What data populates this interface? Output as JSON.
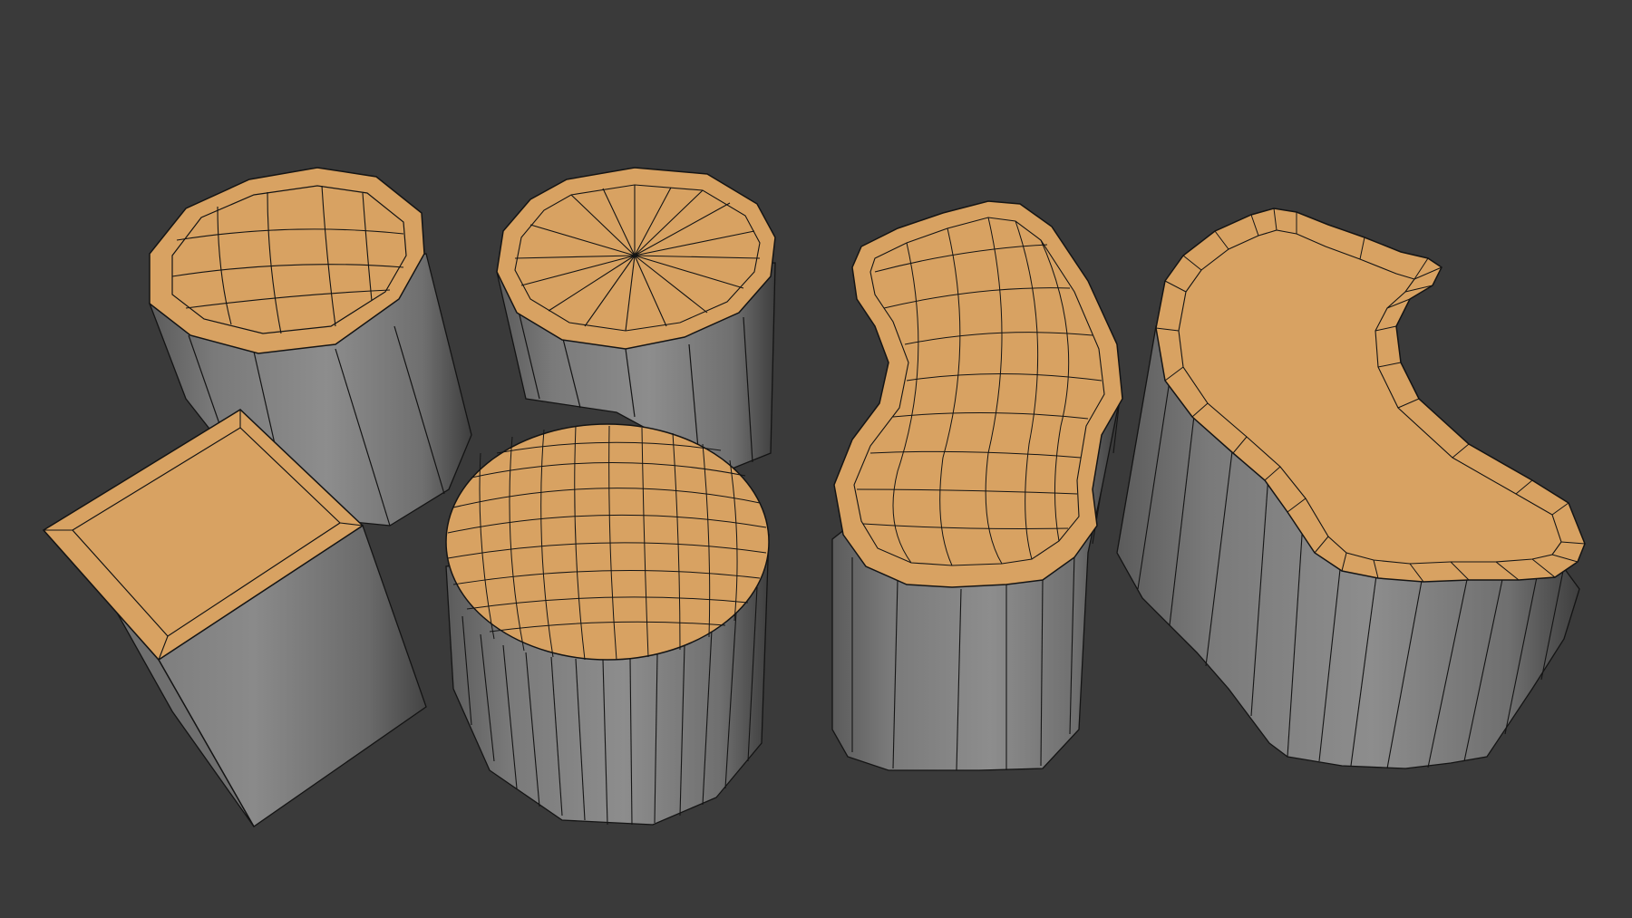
{
  "colors": {
    "background": "#3a3a3a",
    "top_face": "#d8a262",
    "side_face": "#808080",
    "wire": "#141414"
  }
}
